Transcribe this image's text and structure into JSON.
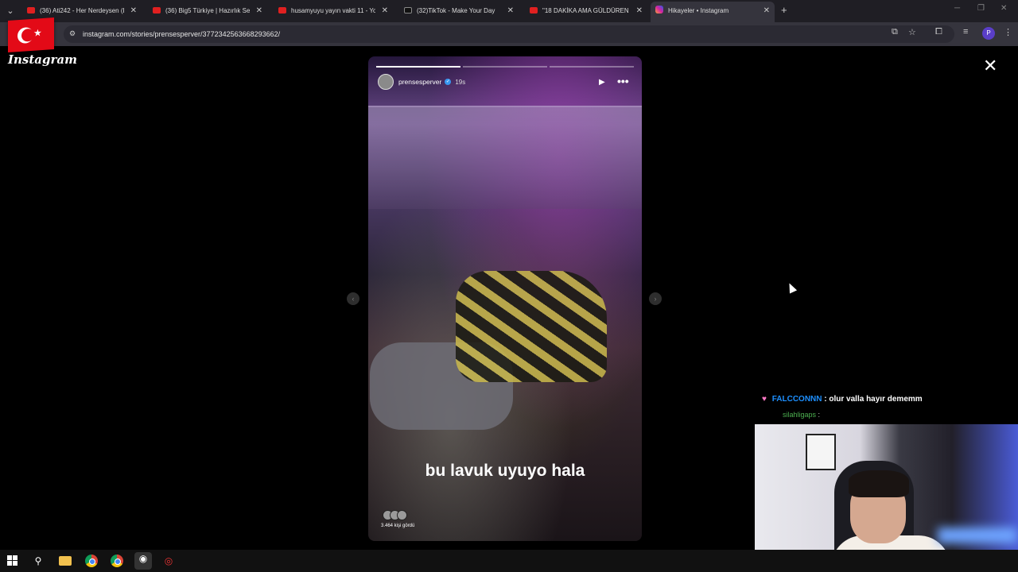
{
  "browser": {
    "tabs": [
      {
        "title": "(36) Ati242 - Her Nerdeysen (Lir",
        "icon": "youtube-icon"
      },
      {
        "title": "(36) Big5 Türkiye | Hazırlık Sezon",
        "icon": "youtube-icon"
      },
      {
        "title": "husamyuyu yayın vakti 11 - You",
        "icon": "youtube-icon"
      },
      {
        "title": "(32)TikTok - Make Your Day",
        "icon": "tiktok-icon"
      },
      {
        "title": "\"18 DAKİKA AMA GÜLDÜREN V",
        "icon": "youtube-icon"
      },
      {
        "title": "Hikayeler • Instagram",
        "icon": "instagram-icon",
        "active": true
      }
    ],
    "url": "instagram.com/stories/prensesperver/3772342563668293662/",
    "profile_initial": "P"
  },
  "page": {
    "logo_text": "Instagram"
  },
  "story": {
    "username": "prensesperver",
    "time_ago": "19s",
    "caption": "bu lavuk uyuyo hala",
    "views_text": "3.464 kişi gördü",
    "progress_segments": 3,
    "progress_done": 1
  },
  "chat": {
    "messages": [
      {
        "user": "FALCCONNN",
        "text": ": olur valla hayır dememm"
      },
      {
        "user": "silahligaps",
        "text": ":"
      }
    ]
  },
  "colors": {
    "chat_user": "#1e90ff",
    "chat_user2": "#4caf50",
    "browser_bg": "#2b2a33"
  }
}
